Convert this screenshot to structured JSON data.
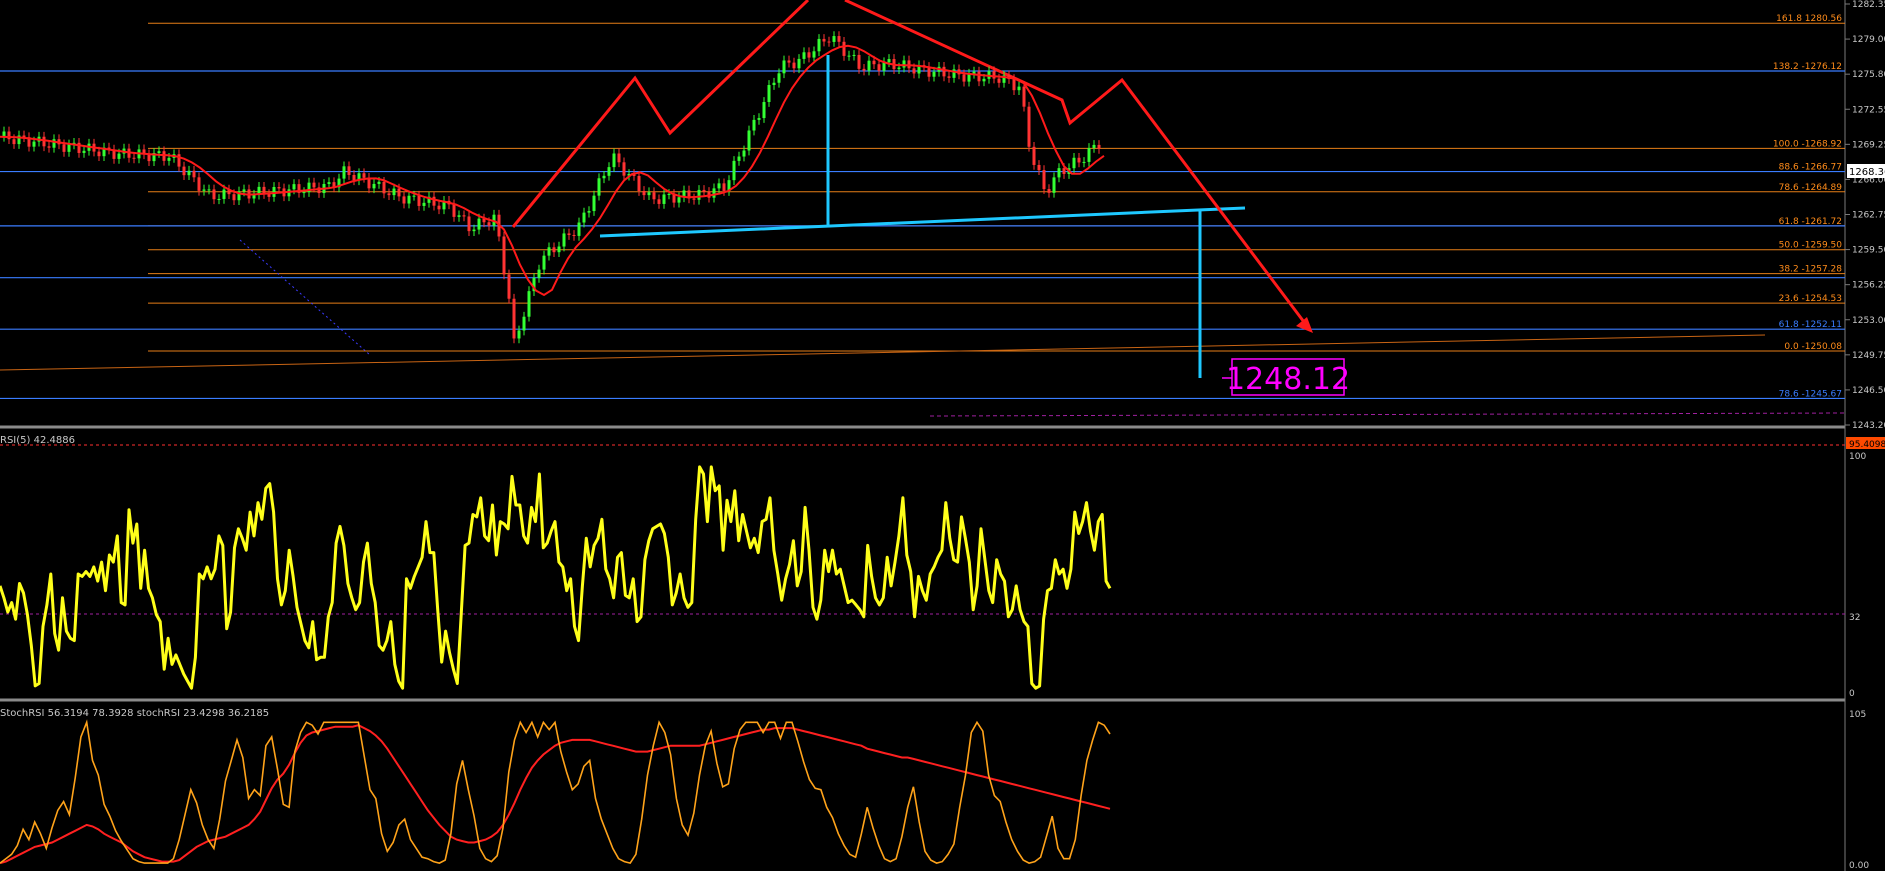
{
  "colors": {
    "background": "#000000",
    "fib_orange": "#ff8c1a",
    "fib_blue": "#3a7dff",
    "pink_label": "#ff00ff",
    "cyan": "#1ec8ff",
    "red_arrow": "#ff1a1a",
    "rsi_yellow": "#ffff1a",
    "stoch_orange": "#ffa31a",
    "stoch_red": "#ff2020",
    "axis_text": "#c8c8c8",
    "candle_up": "#33ff33",
    "candle_down": "#ff3333"
  },
  "price_axis": {
    "ylim": [
      1243.2,
      1282.35
    ],
    "ticks": [
      "1282.35",
      "1279.00",
      "1275.80",
      "1272.55",
      "1269.25",
      "1266.00",
      "1262.75",
      "1259.50",
      "1256.25",
      "1253.00",
      "1249.75",
      "1246.50",
      "1243.20"
    ],
    "current_price": "1268.36"
  },
  "fib_orange": [
    {
      "label": "161.8 1280.56",
      "value": 1280.56
    },
    {
      "label": "138.2 -1276.12",
      "value": 1276.12
    },
    {
      "label": "100.0 -1268.92",
      "value": 1268.92
    },
    {
      "label": "88.6 -1266.77",
      "value": 1266.77
    },
    {
      "label": "78.6 -1264.89",
      "value": 1264.89
    },
    {
      "label": "61.8 -1261.72",
      "value": 1261.72
    },
    {
      "label": "50.0 -1259.50",
      "value": 1259.5
    },
    {
      "label": "38.2 -1257.28",
      "value": 1257.28
    },
    {
      "label": "23.6 -1254.53",
      "value": 1254.53
    },
    {
      "label": "0.0 -1250.08",
      "value": 1250.08
    }
  ],
  "fib_blue": [
    {
      "label": "",
      "value": 1276.12
    },
    {
      "label": "",
      "value": 1266.77
    },
    {
      "label": "",
      "value": 1261.72
    },
    {
      "label": "",
      "value": 1256.9
    },
    {
      "label": "61.8 -1252.11",
      "value": 1252.11
    },
    {
      "label": "78.6 -1245.67",
      "value": 1245.67
    }
  ],
  "target": {
    "label": "1248.12",
    "value": 1248.12
  },
  "rsi_panel": {
    "title": "RSI(5) 42.4886",
    "ylim": [
      0,
      100
    ],
    "ticks": [
      "100",
      "32",
      "0"
    ],
    "right_badge": "95.4098",
    "values": [
      45,
      40,
      34,
      38,
      31,
      46,
      42,
      33,
      20,
      3,
      4,
      28,
      37,
      50,
      25,
      18,
      40,
      26,
      23,
      22,
      50,
      49,
      51,
      49,
      53,
      47,
      55,
      43,
      58,
      55,
      66,
      38,
      37,
      77,
      63,
      71,
      44,
      60,
      44,
      40,
      33,
      30,
      10,
      23,
      12,
      16,
      12,
      8,
      5,
      2,
      15,
      50,
      48,
      53,
      48,
      52,
      66,
      62,
      27,
      34,
      61,
      69,
      65,
      60,
      76,
      66,
      80,
      73,
      86,
      88,
      76,
      48,
      37,
      43,
      60,
      49,
      36,
      29,
      22,
      19,
      30,
      14,
      15,
      15,
      32,
      38,
      63,
      70,
      62,
      46,
      40,
      35,
      38,
      55,
      63,
      46,
      38,
      20,
      18,
      22,
      30,
      12,
      5,
      2,
      48,
      44,
      49,
      53,
      57,
      72,
      59,
      59,
      35,
      13,
      26,
      17,
      10,
      4,
      33,
      62,
      63,
      75,
      74,
      82,
      66,
      64,
      79,
      58,
      72,
      71,
      69,
      91,
      79,
      79,
      66,
      63,
      78,
      72,
      92,
      61,
      63,
      68,
      72,
      55,
      53,
      43,
      48,
      28,
      22,
      45,
      65,
      53,
      62,
      65,
      73,
      52,
      48,
      40,
      57,
      59,
      41,
      40,
      48,
      30,
      32,
      56,
      64,
      69,
      70,
      71,
      67,
      57,
      37,
      42,
      50,
      40,
      36,
      38,
      73,
      95,
      92,
      72,
      95,
      85,
      87,
      60,
      81,
      72,
      85,
      64,
      75,
      68,
      61,
      65,
      59,
      72,
      73,
      82,
      60,
      50,
      39,
      48,
      54,
      64,
      45,
      51,
      78,
      60,
      36,
      31,
      39,
      60,
      51,
      60,
      50,
      52,
      45,
      38,
      39,
      37,
      35,
      32,
      62,
      49,
      40,
      37,
      40,
      57,
      45,
      55,
      66,
      82,
      58,
      51,
      32,
      49,
      43,
      39,
      50,
      53,
      57,
      60,
      80,
      65,
      56,
      55,
      74,
      65,
      55,
      35,
      45,
      69,
      56,
      43,
      38,
      56,
      50,
      47,
      32,
      35,
      45,
      35,
      30,
      28,
      4,
      2,
      3,
      31,
      43,
      44,
      56,
      50,
      52,
      44,
      52,
      76,
      67,
      72,
      80,
      68,
      60,
      72,
      75,
      47,
      44
    ]
  },
  "stoch_panel": {
    "title": "StochRSI 56.3194 78.3928  stochRSI 23.4298 36.2185",
    "ylim": [
      0,
      105
    ],
    "ticks": [
      "105",
      "0.00"
    ],
    "k_values": [
      2,
      5,
      8,
      14,
      25,
      18,
      30,
      22,
      12,
      26,
      38,
      44,
      35,
      60,
      88,
      98,
      72,
      62,
      42,
      34,
      24,
      17,
      11,
      5,
      3,
      2,
      2,
      2,
      2,
      2,
      5,
      18,
      35,
      52,
      43,
      28,
      18,
      12,
      32,
      58,
      72,
      86,
      74,
      46,
      52,
      48,
      82,
      88,
      66,
      42,
      40,
      78,
      91,
      98,
      96,
      90,
      98,
      98,
      98,
      98,
      98,
      98,
      98,
      75,
      52,
      46,
      22,
      10,
      16,
      28,
      32,
      18,
      12,
      6,
      5,
      3,
      2,
      4,
      22,
      56,
      72,
      52,
      34,
      12,
      5,
      3,
      7,
      26,
      64,
      86,
      98,
      91,
      98,
      88,
      98,
      93,
      98,
      78,
      64,
      52,
      56,
      68,
      72,
      46,
      32,
      22,
      12,
      5,
      3,
      2,
      8,
      32,
      62,
      82,
      98,
      91,
      76,
      46,
      28,
      21,
      36,
      62,
      82,
      92,
      70,
      54,
      56,
      80,
      93,
      98,
      98,
      98,
      91,
      98,
      98,
      87,
      98,
      98,
      85,
      71,
      59,
      53,
      52,
      40,
      33,
      22,
      14,
      8,
      6,
      22,
      40,
      26,
      14,
      5,
      3,
      5,
      20,
      40,
      54,
      30,
      10,
      4,
      2,
      3,
      8,
      15,
      40,
      62,
      91,
      98,
      92,
      62,
      48,
      44,
      30,
      18,
      10,
      4,
      2,
      3,
      6,
      20,
      34,
      12,
      5,
      5,
      18,
      48,
      72,
      86,
      98,
      96,
      90
    ],
    "d_values": [
      2,
      3,
      5,
      7,
      9,
      11,
      13,
      14,
      15,
      16,
      18,
      20,
      22,
      24,
      26,
      28,
      27,
      25,
      22,
      20,
      18,
      16,
      13,
      10,
      8,
      6,
      5,
      4,
      3,
      3,
      3,
      4,
      7,
      10,
      13,
      15,
      17,
      18,
      19,
      20,
      22,
      24,
      26,
      28,
      32,
      37,
      45,
      53,
      59,
      63,
      69,
      77,
      84,
      89,
      91,
      92,
      93,
      94,
      95,
      95,
      95,
      95,
      96,
      94,
      92,
      89,
      85,
      80,
      74,
      68,
      62,
      56,
      50,
      44,
      38,
      33,
      28,
      24,
      20,
      18,
      17,
      16,
      16,
      17,
      18,
      20,
      23,
      28,
      35,
      43,
      52,
      60,
      67,
      72,
      76,
      79,
      82,
      84,
      85,
      86,
      86,
      86,
      86,
      85,
      84,
      83,
      82,
      81,
      80,
      79,
      78,
      78,
      78,
      79,
      80,
      81,
      82,
      82,
      82,
      82,
      82,
      82,
      83,
      84,
      85,
      86,
      87,
      88,
      89,
      90,
      91,
      92,
      93,
      93,
      94,
      94,
      94,
      94,
      93,
      92,
      91,
      90,
      89,
      88,
      87,
      86,
      85,
      84,
      83,
      82,
      80,
      79,
      78,
      77,
      76,
      75,
      74,
      74,
      73,
      72,
      71,
      70,
      69,
      68,
      67,
      66,
      65,
      64,
      63,
      62,
      61,
      60,
      59,
      58,
      57,
      56,
      55,
      54,
      53,
      52,
      51,
      50,
      49,
      48,
      47,
      46,
      45,
      44,
      43,
      42,
      41,
      40,
      39
    ]
  }
}
